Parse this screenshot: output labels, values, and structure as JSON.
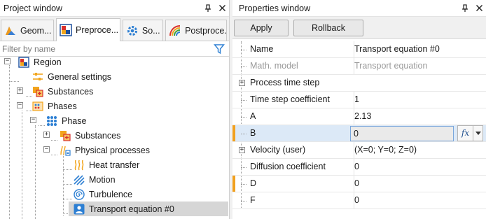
{
  "project_window": {
    "title": "Project window",
    "pin_icon": "pin-icon",
    "close_icon": "close-icon",
    "tabs": [
      {
        "label": "Geom...",
        "icon": "geometry-icon",
        "active": false
      },
      {
        "label": "Preproce...",
        "icon": "preprocessor-icon",
        "active": true
      },
      {
        "label": "So...",
        "icon": "solver-gear-icon",
        "active": false
      },
      {
        "label": "Postproce...",
        "icon": "postprocessor-icon",
        "active": false
      }
    ],
    "filter": {
      "placeholder": "Filter by name",
      "value": ""
    },
    "tree": [
      {
        "label": "Region",
        "icon": "region-icon",
        "expanded": true
      },
      {
        "label": "General settings",
        "icon": "settings-sliders-icon"
      },
      {
        "label": "Substances",
        "icon": "substances-icon",
        "expanded": false
      },
      {
        "label": "Phases",
        "icon": "phases-icon",
        "expanded": true
      },
      {
        "label": "Phase",
        "icon": "phase-dots-icon",
        "expanded": true
      },
      {
        "label": "Substances",
        "icon": "substances-icon",
        "expanded": false
      },
      {
        "label": "Physical processes",
        "icon": "physical-processes-icon",
        "expanded": true
      },
      {
        "label": "Heat transfer",
        "icon": "heat-transfer-icon"
      },
      {
        "label": "Motion",
        "icon": "motion-icon"
      },
      {
        "label": "Turbulence",
        "icon": "turbulence-icon"
      },
      {
        "label": "Transport equation #0",
        "icon": "transport-equation-icon",
        "selected": true
      }
    ]
  },
  "properties_window": {
    "title": "Properties window",
    "pin_icon": "pin-icon",
    "close_icon": "close-icon",
    "buttons": {
      "apply": "Apply",
      "rollback": "Rollback"
    },
    "rows": [
      {
        "name": "Name",
        "value": "Transport equation #0"
      },
      {
        "name": "Math. model",
        "value": "Transport equation",
        "readonly": true
      },
      {
        "name": "Process time step",
        "value": "",
        "expandable": true
      },
      {
        "name": "Time step coefficient",
        "value": "1"
      },
      {
        "name": "A",
        "value": "2.13"
      },
      {
        "name": "B",
        "value": "0",
        "modified": true,
        "editing": true
      },
      {
        "name": "Velocity (user)",
        "value": "(X=0; Y=0; Z=0)",
        "expandable": true
      },
      {
        "name": "Diffusion coefficient",
        "value": "0"
      },
      {
        "name": "D",
        "value": "0",
        "modified": true
      },
      {
        "name": "F",
        "value": "0"
      }
    ],
    "fx_label": "fx",
    "dropdown_icon": "chevron-down-icon"
  },
  "colors": {
    "accent_orange": "#f1a01e",
    "selection_blue": "#dce9f7",
    "tree_selected": "#d6d6d6",
    "funnel_blue": "#2d7fd3"
  }
}
